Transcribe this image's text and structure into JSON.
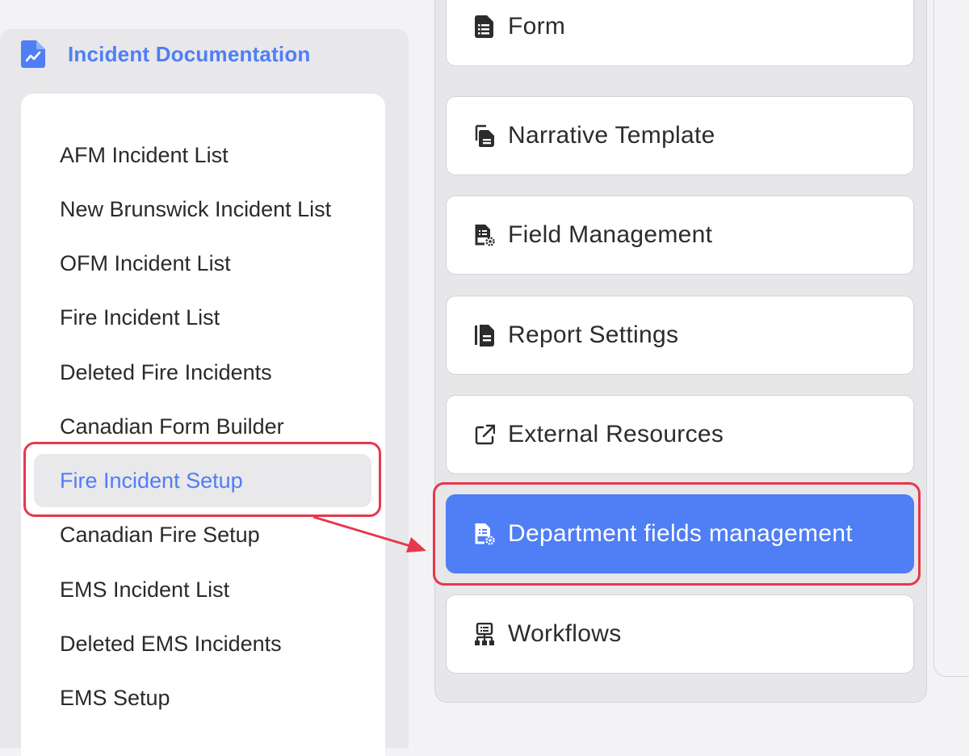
{
  "sidebar": {
    "header": {
      "title": "Incident Documentation",
      "icon": "document-chart-icon"
    },
    "items": [
      {
        "label": "AFM Incident List"
      },
      {
        "label": "New Brunswick Incident List"
      },
      {
        "label": "OFM Incident List"
      },
      {
        "label": "Fire Incident List"
      },
      {
        "label": "Deleted Fire Incidents"
      },
      {
        "label": "Canadian Form Builder"
      },
      {
        "label": "Fire Incident Setup",
        "active": true
      },
      {
        "label": "Canadian Fire Setup"
      },
      {
        "label": "EMS Incident List"
      },
      {
        "label": "Deleted EMS Incidents"
      },
      {
        "label": "EMS Setup"
      }
    ]
  },
  "menu": {
    "items": [
      {
        "label": "Form",
        "icon": "form-list-icon"
      },
      {
        "label": "Narrative Template",
        "icon": "copy-document-icon"
      },
      {
        "label": "Field Management",
        "icon": "field-settings-icon"
      },
      {
        "label": "Report Settings",
        "icon": "report-document-icon"
      },
      {
        "label": "External Resources",
        "icon": "external-link-icon"
      },
      {
        "label": "Department fields management",
        "icon": "field-settings-icon",
        "active": true
      },
      {
        "label": "Workflows",
        "icon": "workflow-icon"
      }
    ]
  },
  "colors": {
    "accent": "#4f7ef5",
    "annotation": "#e5384b",
    "text": "#2a2a2a",
    "sidebar_bg": "#e8e7ea",
    "card_bg": "#ffffff"
  }
}
